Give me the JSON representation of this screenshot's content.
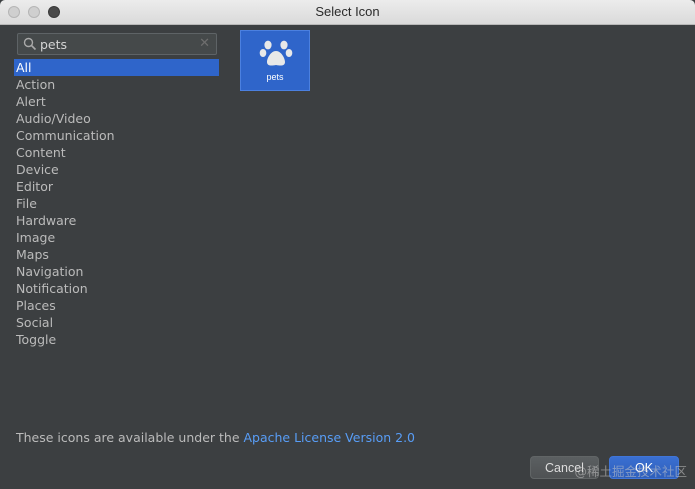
{
  "window": {
    "title": "Select Icon"
  },
  "search": {
    "value": "pets",
    "placeholder": ""
  },
  "categories": [
    "All",
    "Action",
    "Alert",
    "Audio/Video",
    "Communication",
    "Content",
    "Device",
    "Editor",
    "File",
    "Hardware",
    "Image",
    "Maps",
    "Navigation",
    "Notification",
    "Places",
    "Social",
    "Toggle"
  ],
  "selected_category": "All",
  "icons": [
    {
      "label": "pets",
      "icon": "paw-icon"
    }
  ],
  "footer": {
    "license_prefix": "These icons are available under the ",
    "license_link": "Apache License Version 2.0",
    "cancel_label": "Cancel",
    "ok_label": "OK"
  },
  "watermark": "@稀土掘金技术社区",
  "colors": {
    "accent": "#2f65ca",
    "link": "#589df6",
    "background": "#3c3f41"
  }
}
